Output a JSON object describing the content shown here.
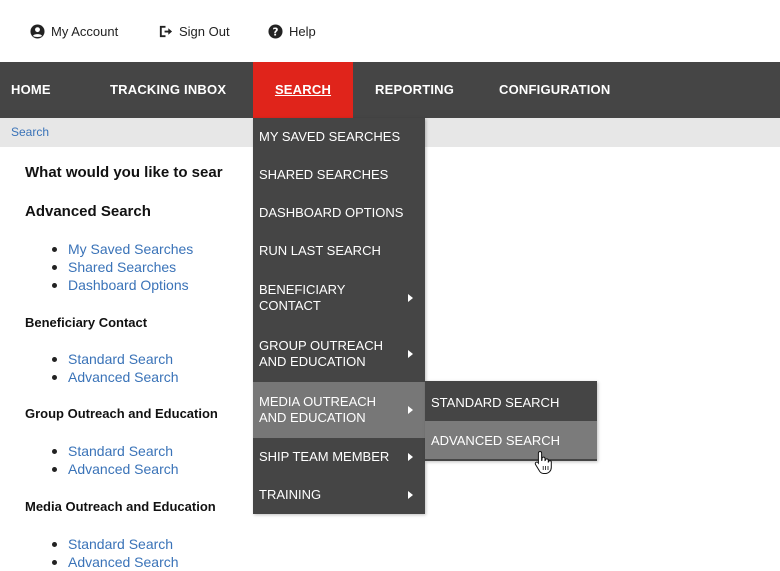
{
  "topbar": {
    "my_account": "My Account",
    "sign_out": "Sign Out",
    "help": "Help"
  },
  "nav": {
    "home": "HOME",
    "tracking_inbox": "TRACKING INBOX",
    "search": "SEARCH",
    "reporting": "REPORTING",
    "configuration": "CONFIGURATION",
    "active": "SEARCH",
    "active_color": "#e0241b"
  },
  "breadcrumb": "Search",
  "content": {
    "question": "What would you like to sear",
    "advanced_search": {
      "title": "Advanced Search",
      "links": [
        "My Saved Searches",
        "Shared Searches",
        "Dashboard Options"
      ]
    },
    "beneficiary_contact": {
      "title": "Beneficiary Contact",
      "links": [
        "Standard Search",
        "Advanced Search"
      ]
    },
    "group_outreach": {
      "title": "Group Outreach and Education",
      "links": [
        "Standard Search",
        "Advanced Search"
      ]
    },
    "media_outreach": {
      "title": "Media Outreach and Education",
      "links": [
        "Standard Search",
        "Advanced Search"
      ]
    }
  },
  "dropdown": {
    "items": [
      {
        "label": "MY SAVED SEARCHES",
        "has_submenu": false
      },
      {
        "label": "SHARED SEARCHES",
        "has_submenu": false
      },
      {
        "label": "DASHBOARD OPTIONS",
        "has_submenu": false
      },
      {
        "label": "RUN LAST SEARCH",
        "has_submenu": false
      },
      {
        "label_line1": "BENEFICIARY",
        "label_line2": "CONTACT",
        "has_submenu": true
      },
      {
        "label_line1": "GROUP OUTREACH",
        "label_line2": "AND EDUCATION",
        "has_submenu": true
      },
      {
        "label_line1": "MEDIA OUTREACH",
        "label_line2": "AND EDUCATION",
        "has_submenu": true,
        "highlighted": true
      },
      {
        "label": "SHIP TEAM MEMBER",
        "has_submenu": true
      },
      {
        "label": "TRAINING",
        "has_submenu": true
      }
    ]
  },
  "submenu": {
    "items": [
      {
        "label": "STANDARD SEARCH"
      },
      {
        "label": "ADVANCED SEARCH",
        "hovered": true
      }
    ]
  },
  "icons": {
    "account": "user-circle-icon",
    "sign_out": "sign-out-icon",
    "help": "question-circle-icon",
    "cursor": "hand-pointer-icon"
  }
}
